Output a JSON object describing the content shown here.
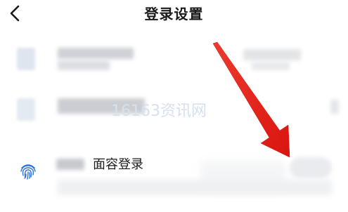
{
  "header": {
    "title": "登录设置",
    "back_icon": "chevron-left-icon"
  },
  "rows": [
    {
      "redacted": true
    },
    {
      "redacted": true
    },
    {
      "label": "面容登录",
      "icon": "fingerprint-icon",
      "redacted_prefix": true
    }
  ],
  "watermark": "16163资讯网",
  "colors": {
    "arrow": "#e8231b",
    "icon_blue": "#2a73d9",
    "title_text": "#1a1a1a"
  }
}
